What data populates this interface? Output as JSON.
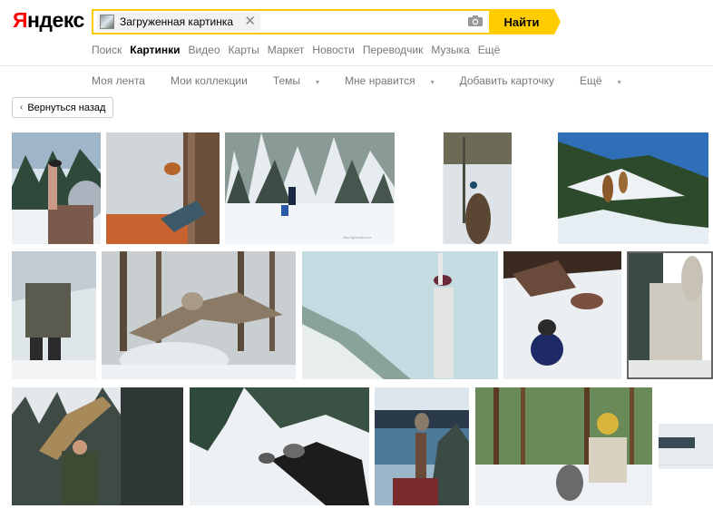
{
  "logo": {
    "first": "Я",
    "rest": "ндекс"
  },
  "search": {
    "chip_text": "Загруженная картинка",
    "close": "✕",
    "button": "Найти"
  },
  "nav": [
    "Поиск",
    "Картинки",
    "Видео",
    "Карты",
    "Маркет",
    "Новости",
    "Переводчик",
    "Музыка",
    "Ещё"
  ],
  "subnav": [
    {
      "label": "Моя лента"
    },
    {
      "label": "Мои коллекции"
    },
    {
      "label": "Темы",
      "caret": "▾"
    },
    {
      "label": "Мне нравится",
      "caret": "▾"
    },
    {
      "label": "Добавить карточку"
    },
    {
      "label": "Ещё",
      "caret": "▾"
    }
  ],
  "back": {
    "chevron": "‹",
    "label": "Вернуться назад"
  },
  "colors": {
    "accent": "#ffcc00",
    "brand_red": "#ff0000"
  },
  "results_caption": "http://globalsu.me"
}
